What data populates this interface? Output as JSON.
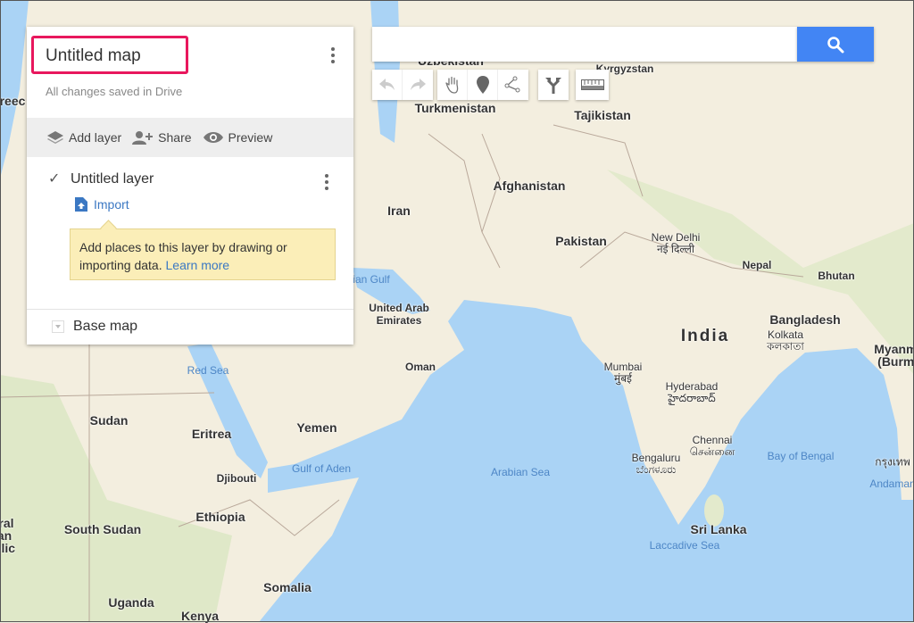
{
  "panel": {
    "map_title": "Untitled map",
    "save_status": "All changes saved in Drive",
    "actions": {
      "add_layer": "Add layer",
      "share": "Share",
      "preview": "Preview"
    },
    "layer": {
      "name": "Untitled layer",
      "checked": true,
      "import_label": "Import"
    },
    "tooltip": {
      "text": "Add places to this layer by drawing or importing data.",
      "link": "Learn more"
    },
    "base_map_label": "Base map"
  },
  "search": {
    "value": "",
    "placeholder": ""
  },
  "toolbar": {
    "tools": [
      "undo-icon",
      "redo-icon",
      "hand-icon",
      "marker-icon",
      "draw-line-icon",
      "directions-icon",
      "ruler-icon"
    ]
  },
  "colors": {
    "accent": "#4285f4",
    "highlight_box": "#e8175d",
    "water": "#aad3f5",
    "land": "#f3eedf"
  },
  "map": {
    "labels": [
      {
        "text": "Uzbekistan",
        "kind": "country"
      },
      {
        "text": "Kyrgyzstan",
        "kind": "country-small"
      },
      {
        "text": "Turkmenistan",
        "kind": "country"
      },
      {
        "text": "Tajikistan",
        "kind": "country"
      },
      {
        "text": "Afghanistan",
        "kind": "country"
      },
      {
        "text": "Iran",
        "kind": "country"
      },
      {
        "text": "Pakistan",
        "kind": "country"
      },
      {
        "text": "New Delhi\nनई दिल्ली",
        "kind": "city"
      },
      {
        "text": "Nepal",
        "kind": "country-small"
      },
      {
        "text": "Bhutan",
        "kind": "country-small"
      },
      {
        "text": "Bangladesh",
        "kind": "country"
      },
      {
        "text": "India",
        "kind": "country-big"
      },
      {
        "text": "Kolkata\nকলকাতা",
        "kind": "city"
      },
      {
        "text": "Myanmar\n(Burma)",
        "kind": "country"
      },
      {
        "text": "Mumbai\nमुंबई",
        "kind": "city"
      },
      {
        "text": "Hyderabad\nహైదరాబాద్",
        "kind": "city"
      },
      {
        "text": "Chennai\nசென்னை",
        "kind": "city"
      },
      {
        "text": "Bengaluru\nಬೆಂಗಳೂರು",
        "kind": "city"
      },
      {
        "text": "Bay of Bengal",
        "kind": "water"
      },
      {
        "text": "Arabian Sea",
        "kind": "water"
      },
      {
        "text": "Sri Lanka",
        "kind": "country"
      },
      {
        "text": "Laccadive Sea",
        "kind": "water"
      },
      {
        "text": "Andaman",
        "kind": "water"
      },
      {
        "text": "กรุงเทพ",
        "kind": "city"
      },
      {
        "text": "sian Gulf",
        "kind": "water"
      },
      {
        "text": "United Arab\nEmirates",
        "kind": "country-small"
      },
      {
        "text": "Oman",
        "kind": "country-small"
      },
      {
        "text": "Red Sea",
        "kind": "water"
      },
      {
        "text": "Sudan",
        "kind": "country"
      },
      {
        "text": "Eritrea",
        "kind": "country"
      },
      {
        "text": "Yemen",
        "kind": "country"
      },
      {
        "text": "Gulf of Aden",
        "kind": "water"
      },
      {
        "text": "Djibouti",
        "kind": "country-small"
      },
      {
        "text": "Ethiopia",
        "kind": "country"
      },
      {
        "text": "South Sudan",
        "kind": "country"
      },
      {
        "text": "Somalia",
        "kind": "country"
      },
      {
        "text": "Uganda",
        "kind": "country"
      },
      {
        "text": "Kenya",
        "kind": "country"
      },
      {
        "text": "Iral\nan\nolic",
        "kind": "country"
      },
      {
        "text": "reec",
        "kind": "country"
      }
    ]
  }
}
